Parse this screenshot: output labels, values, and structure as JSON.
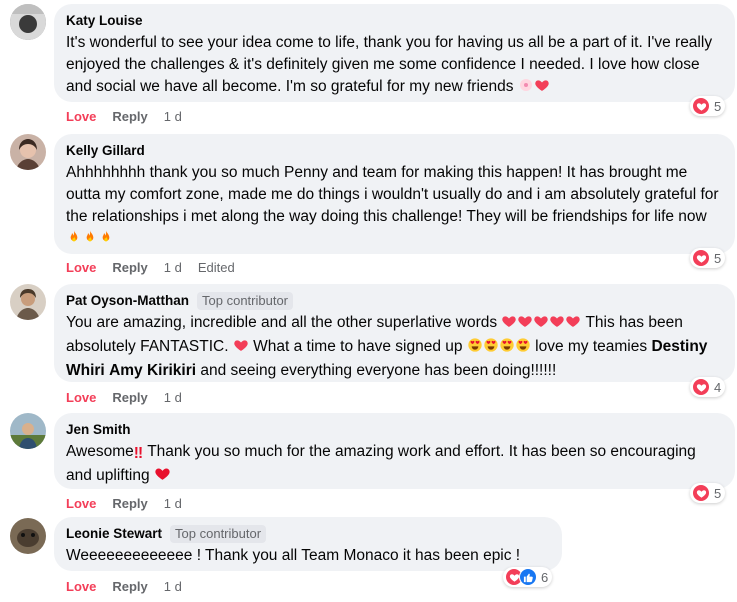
{
  "comments": [
    {
      "name": "Katy Louise",
      "badge": "",
      "text": "It's wonderful to see your idea come to life, thank you for having us all be a part of it. I've really enjoyed the challenges & it's definitely given me some confidence I needed. I love how close and social we have all become. I'm so grateful for my new friends",
      "love": "Love",
      "reply": "Reply",
      "time": "1 d",
      "edited": "",
      "reaction_count": "5"
    },
    {
      "name": "Kelly Gillard",
      "badge": "",
      "text": "Ahhhhhhhh thank you so much Penny and team for making this happen! It has brought me outta my comfort zone, made me do things i wouldn't usually do and i am absolutely grateful for the relationships i met along the way doing this challenge! They will be friendships for life now",
      "love": "Love",
      "reply": "Reply",
      "time": "1 d",
      "edited": "Edited",
      "reaction_count": "5"
    },
    {
      "name": "Pat Oyson-Matthan",
      "badge": "Top contributor",
      "text_part1": "You are amazing, incredible and all the other superlative words",
      "text_part2": "This has been absolutely FANTASTIC.",
      "text_part3": "What a time to have signed up",
      "text_part4": "love my teamies",
      "tag1": "Destiny Whiri",
      "tag2": "Amy Kirikiri",
      "text_part5": "and seeing everything everyone has been doing!!!!!!",
      "love": "Love",
      "reply": "Reply",
      "time": "1 d",
      "edited": "",
      "reaction_count": "4"
    },
    {
      "name": "Jen Smith",
      "badge": "",
      "text_part1": "Awesome",
      "text_part2": "Thank you so much for the amazing work and effort. It has been so encouraging and uplifting",
      "love": "Love",
      "reply": "Reply",
      "time": "1 d",
      "edited": "",
      "reaction_count": "5"
    },
    {
      "name": "Leonie Stewart",
      "badge": "Top contributor",
      "text": "Weeeeeeeeeeeee ! Thank you all Team Monaco it has been epic !",
      "love": "Love",
      "reply": "Reply",
      "time": "1 d",
      "edited": "",
      "reaction_count": "6"
    }
  ],
  "colors": {
    "love_red": "#f33e58",
    "bubble_bg": "#f0f2f5",
    "meta_gray": "#65676b",
    "like_blue": "#1877f2"
  },
  "icons": [
    "heart-reaction-icon",
    "like-reaction-icon",
    "fire-emoji-icon",
    "sparkling-heart-emoji-icon",
    "heart-eyes-emoji-icon",
    "double-exclamation-icon",
    "red-heart-emoji-icon",
    "blossom-emoji-icon"
  ]
}
